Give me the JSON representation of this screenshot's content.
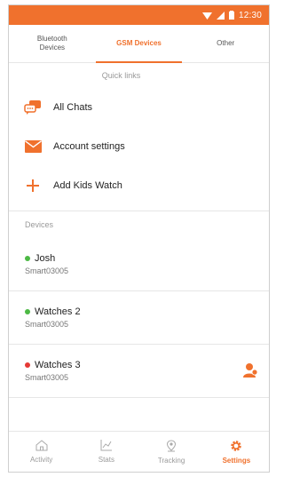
{
  "status_bar": {
    "time": "12:30"
  },
  "tabs": [
    {
      "label_line1": "Bluetooth",
      "label_line2": "Devices",
      "active": false
    },
    {
      "label_line1": "GSM Devices",
      "label_line2": "",
      "active": true
    },
    {
      "label_line1": "Other",
      "label_line2": "",
      "active": false
    }
  ],
  "quick_links": {
    "title": "Quick links",
    "items": [
      {
        "label": "All Chats",
        "icon": "chat-icon"
      },
      {
        "label": "Account settings",
        "icon": "envelope-icon"
      },
      {
        "label": "Add Kids Watch",
        "icon": "plus-icon"
      }
    ]
  },
  "devices": {
    "title": "Devices",
    "items": [
      {
        "name": "Josh",
        "sub": "Smart03005",
        "status_color": "#4cb944"
      },
      {
        "name": "Watches 2",
        "sub": "Smart03005",
        "status_color": "#4cb944"
      },
      {
        "name": "Watches 3",
        "sub": "Smart03005",
        "status_color": "#e53935",
        "action_icon": "user-alert-icon"
      }
    ]
  },
  "bottom_nav": [
    {
      "label": "Activity",
      "icon": "home-icon",
      "active": false
    },
    {
      "label": "Stats",
      "icon": "chart-icon",
      "active": false
    },
    {
      "label": "Tracking",
      "icon": "location-pin-icon",
      "active": false
    },
    {
      "label": "Settings",
      "icon": "gear-icon",
      "active": true
    }
  ],
  "colors": {
    "accent": "#f0712d",
    "online": "#4cb944",
    "offline": "#e53935"
  }
}
